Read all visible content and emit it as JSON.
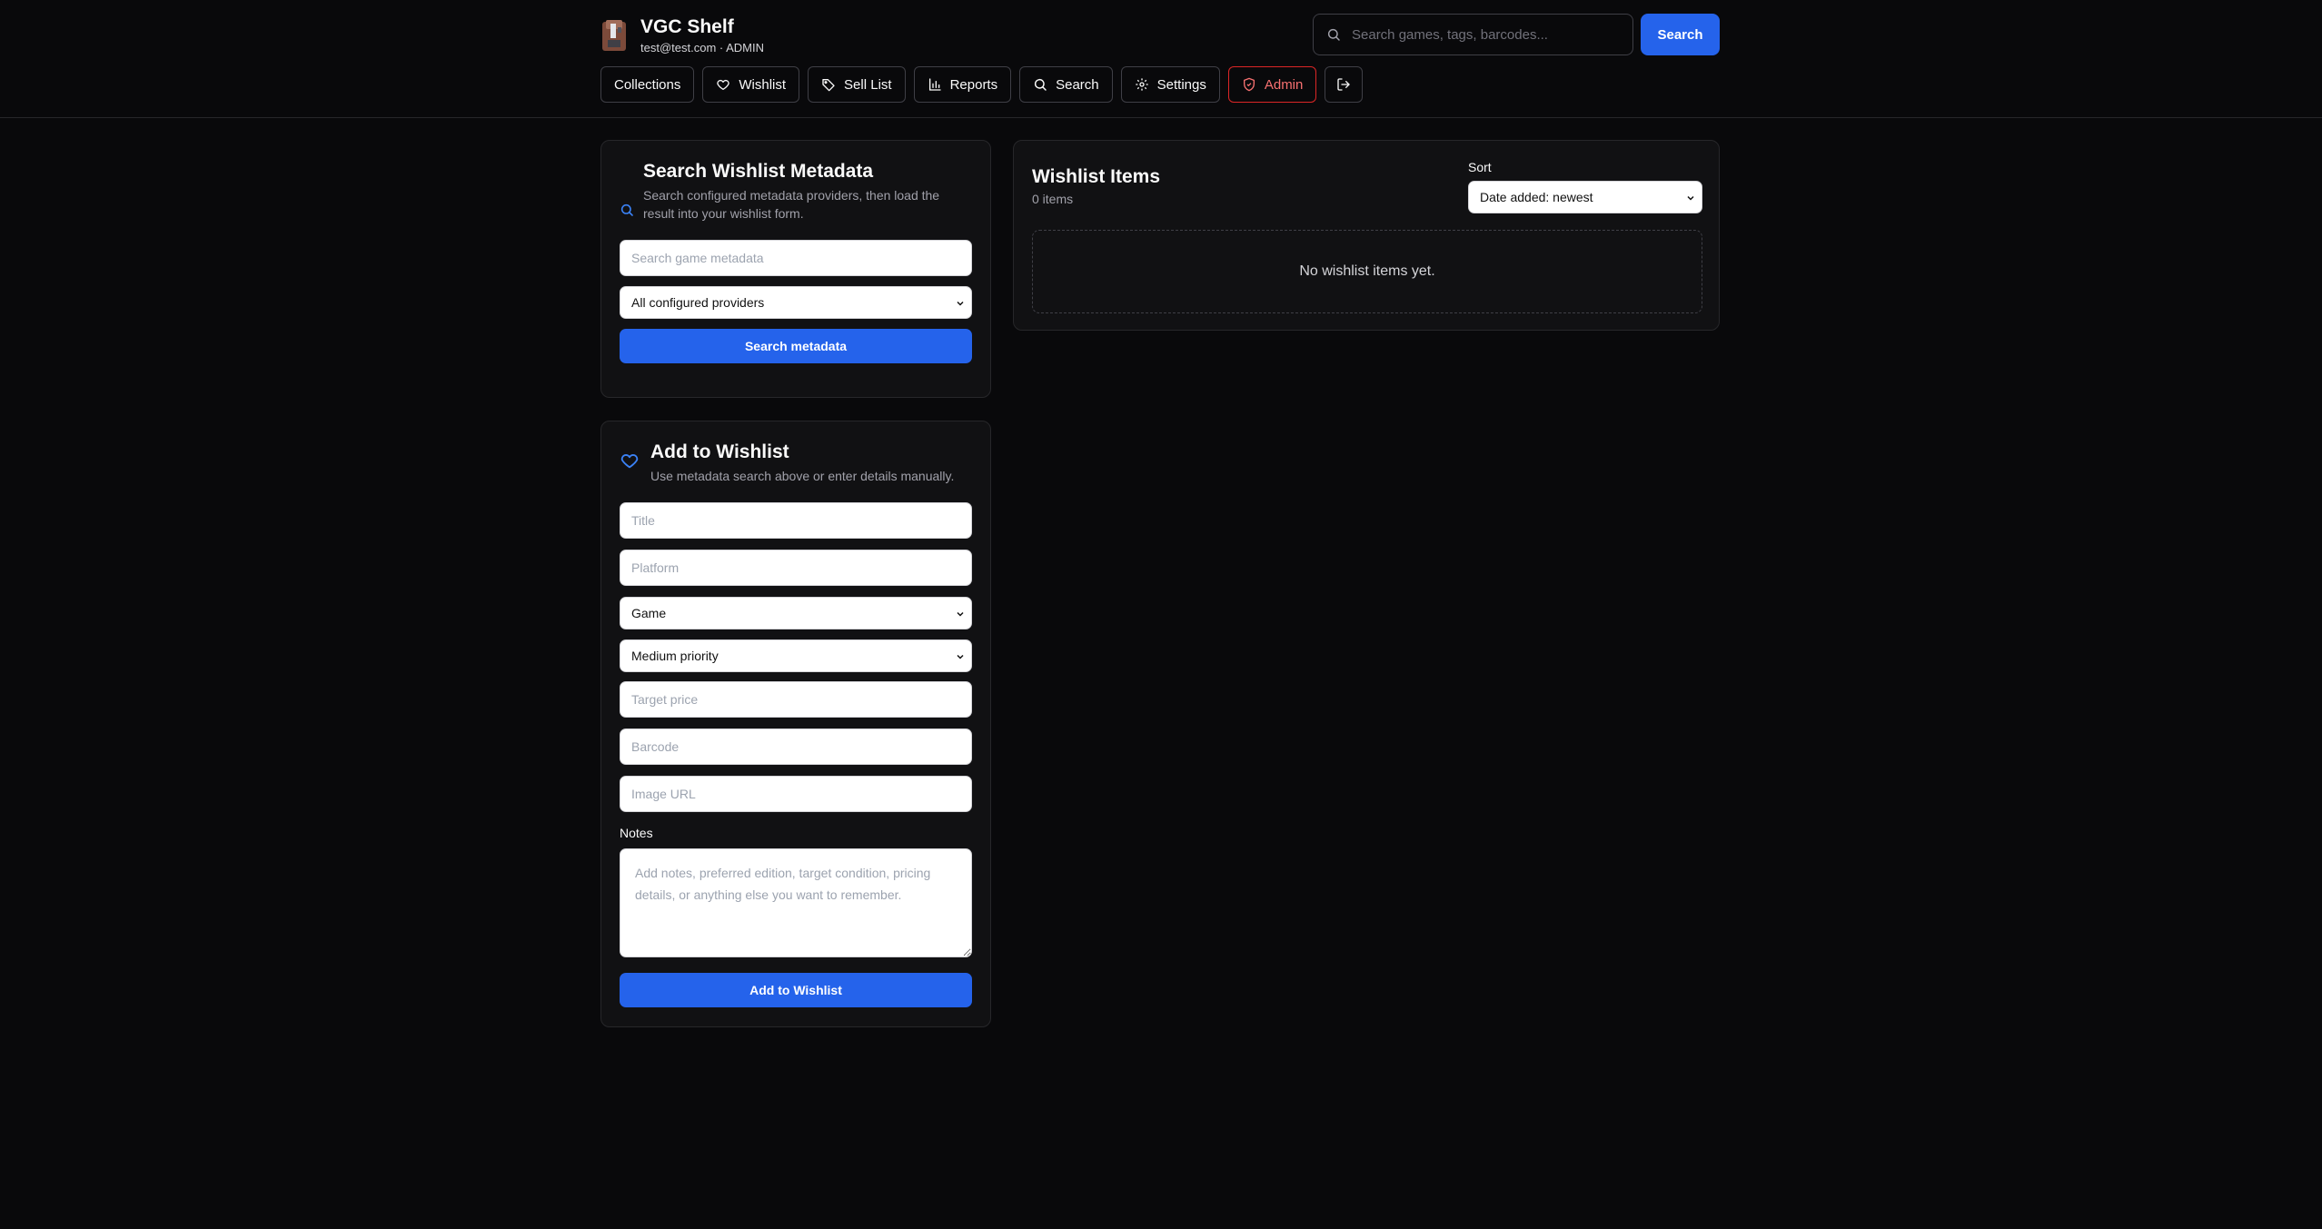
{
  "app": {
    "title": "VGC Shelf",
    "user_line": "test@test.com · ADMIN"
  },
  "header_search": {
    "placeholder": "Search games, tags, barcodes...",
    "button_label": "Search"
  },
  "nav": {
    "collections": "Collections",
    "wishlist": "Wishlist",
    "sell_list": "Sell List",
    "reports": "Reports",
    "search": "Search",
    "settings": "Settings",
    "admin": "Admin"
  },
  "metadata_search": {
    "title": "Search Wishlist Metadata",
    "description": "Search configured metadata providers, then load the result into your wishlist form.",
    "input_placeholder": "Search game metadata",
    "provider_selected": "All configured providers",
    "button_label": "Search metadata"
  },
  "add_form": {
    "title": "Add to Wishlist",
    "description": "Use metadata search above or enter details manually.",
    "title_placeholder": "Title",
    "platform_placeholder": "Platform",
    "type_selected": "Game",
    "priority_selected": "Medium priority",
    "target_price_placeholder": "Target price",
    "barcode_placeholder": "Barcode",
    "image_url_placeholder": "Image URL",
    "notes_label": "Notes",
    "notes_placeholder": "Add notes, preferred edition, target condition, pricing details, or anything else you want to remember.",
    "button_label": "Add to Wishlist"
  },
  "wishlist_items": {
    "title": "Wishlist Items",
    "count": "0 items",
    "sort_label": "Sort",
    "sort_selected": "Date added: newest",
    "empty_text": "No wishlist items yet."
  },
  "colors": {
    "background": "#09090b",
    "card": "#111113",
    "border": "#27272a",
    "accent": "#2563eb",
    "danger": "#dc2626"
  }
}
